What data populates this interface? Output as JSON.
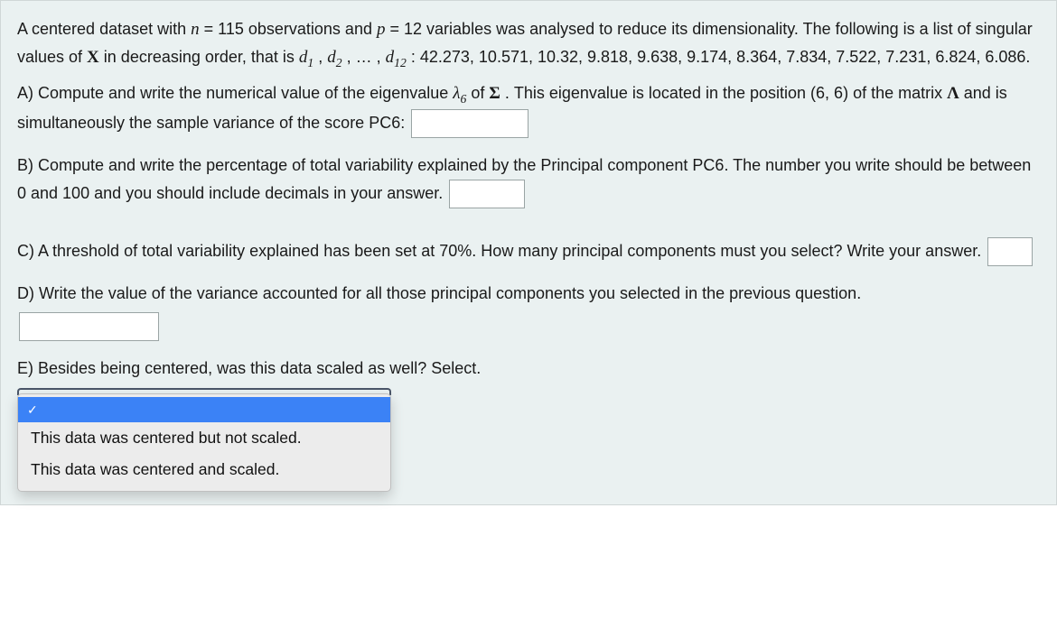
{
  "intro": {
    "t1": "A centered dataset with ",
    "n": "n",
    "eq1": " = ",
    "nval": "115",
    "t2": " observations and ",
    "p": "p",
    "eq2": " = ",
    "pval": "12",
    "t3": " variables was analysed to reduce its dimensionality. The following is a list of singular values of ",
    "X": "X",
    "t4": " in decreasing order, that is ",
    "d1": "d",
    "d1s": "1",
    "comma1": " , ",
    "d2": "d",
    "d2s": "2",
    "comma2": ", … , ",
    "d12": "d",
    "d12s": "12",
    "t5": " : 42.273, 10.571, 10.32, 9.818, 9.638, 9.174, 8.364, 7.834, 7.522, 7.231, 6.824, 6.086."
  },
  "A": {
    "t1": "A) Compute and write the numerical value of the eigenvalue ",
    "lam": "λ",
    "lams": "6",
    "t2": " of ",
    "Sigma": "Σ",
    "t3": ". This eigenvalue is located in the position ",
    "pos": "(6, 6)",
    "t4": " of the matrix ",
    "Lambda": "Λ",
    "t5": " and is simultaneously the sample variance of the score PC6: "
  },
  "B": {
    "t1": "B) Compute and write the percentage of total variability explained by the Principal component PC6. The number you write should be between 0 and 100 and you should include decimals in your answer. "
  },
  "C": {
    "t1": "C) A threshold of total variability explained has been set at 70%. How many principal components must you select? Write your answer. "
  },
  "D": {
    "t1": "D) Write the value of the variance accounted for all those principal components you selected in the previous question."
  },
  "E": {
    "t1": "E) Besides being centered, was this data scaled as well? Select."
  },
  "dropdown": {
    "check": "✓",
    "opt1": "This data was centered but not scaled.",
    "opt2": "This data was centered and scaled."
  }
}
